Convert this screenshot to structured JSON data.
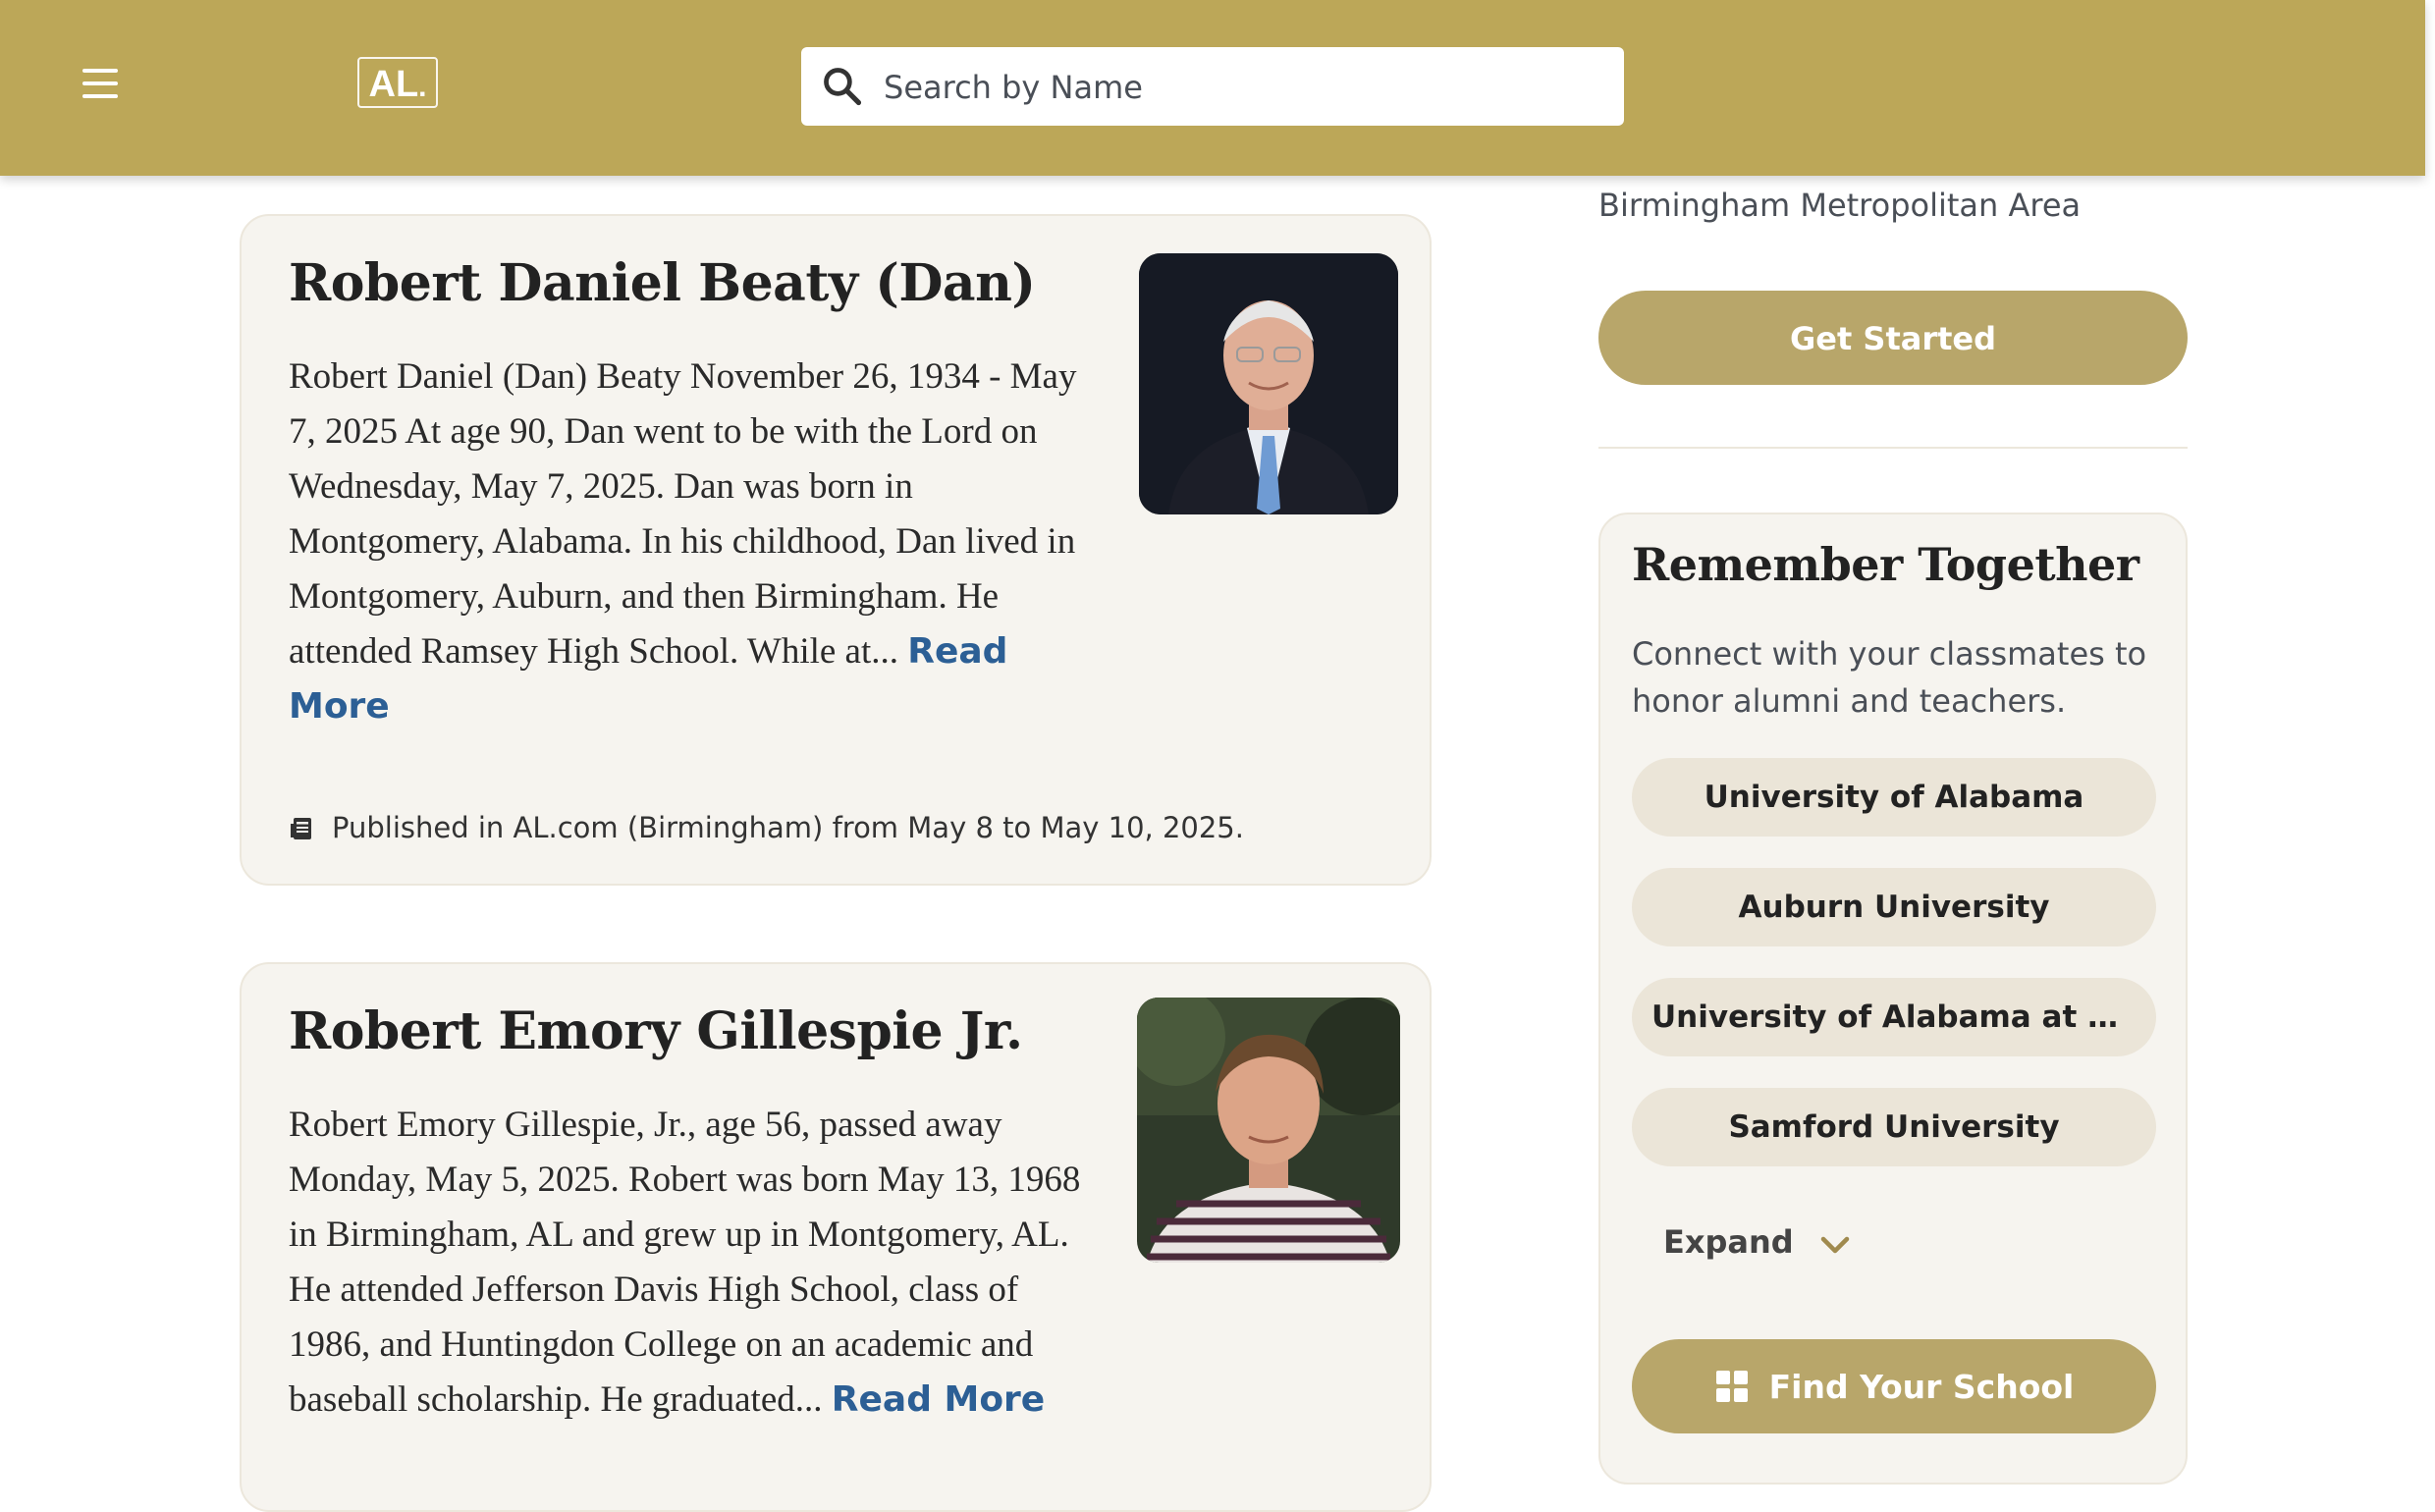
{
  "header": {
    "menu_icon": "hamburger-menu-icon",
    "logo_text": "AL",
    "search_placeholder": "Search by Name",
    "search_icon": "search-icon",
    "colors": {
      "header_bg": "#bca758",
      "accent_gold": "#b8a66a",
      "link_blue": "#2c5f95"
    }
  },
  "obituaries": [
    {
      "name": "Robert Daniel Beaty (Dan)",
      "excerpt": "Robert Daniel (Dan) Beaty November 26, 1934 - May 7, 2025 At age 90, Dan went to be with the Lord on Wednesday, May 7, 2025. Dan was born in Montgomery, Alabama. In his childhood, Dan lived in Montgomery, Auburn, and then Birmingham. He attended Ramsey High School. While at...",
      "read_more": "Read More",
      "published": "Published in AL.com (Birmingham) from May 8 to May 10, 2025.",
      "publication_icon": "newspaper-icon"
    },
    {
      "name": "Robert Emory Gillespie Jr.",
      "excerpt": "Robert Emory Gillespie, Jr., age 56, passed away Monday, May 5, 2025. Robert was born May 13, 1968 in Birmingham, AL and grew up in Montgomery, AL. He attended Jefferson Davis High School, class of 1986, and Huntingdon College on an academic and baseball scholarship. He graduated...",
      "read_more": "Read More"
    }
  ],
  "sidebar": {
    "metro_text": "Birmingham Metropolitan Area",
    "get_started_label": "Get Started",
    "remember": {
      "title": "Remember Together",
      "description": "Connect with your classmates to honor alumni and teachers.",
      "schools": [
        "University of Alabama",
        "Auburn University",
        "University of Alabama at Bir...",
        "Samford University"
      ],
      "expand_label": "Expand",
      "find_school_label": "Find Your School",
      "find_school_icon": "grid-icon"
    }
  }
}
